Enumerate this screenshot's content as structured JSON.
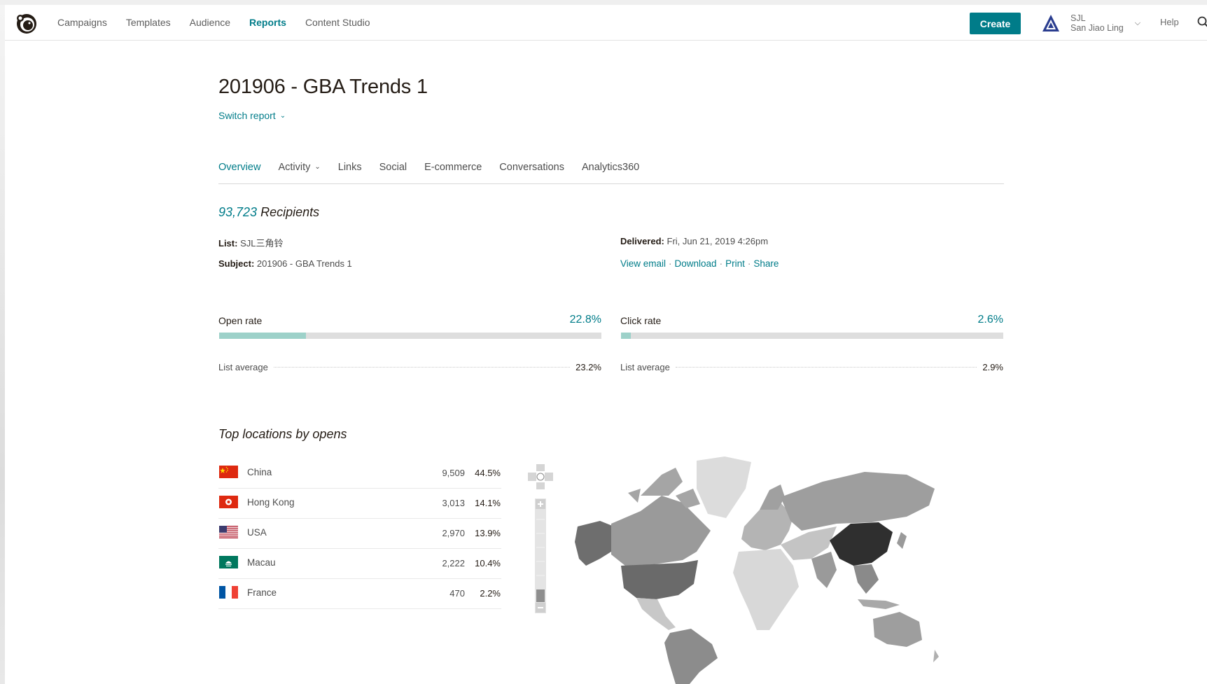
{
  "header": {
    "nav": [
      {
        "label": "Campaigns",
        "active": false
      },
      {
        "label": "Templates",
        "active": false
      },
      {
        "label": "Audience",
        "active": false
      },
      {
        "label": "Reports",
        "active": true
      },
      {
        "label": "Content Studio",
        "active": false
      }
    ],
    "create_label": "Create",
    "account": {
      "short": "SJL",
      "name": "San Jiao Ling"
    },
    "help_label": "Help"
  },
  "report": {
    "title": "201906 - GBA Trends 1",
    "switch_label": "Switch report",
    "tabs": [
      {
        "label": "Overview",
        "active": true
      },
      {
        "label": "Activity",
        "active": false
      },
      {
        "label": "Links",
        "active": false
      },
      {
        "label": "Social",
        "active": false
      },
      {
        "label": "E-commerce",
        "active": false
      },
      {
        "label": "Conversations",
        "active": false
      },
      {
        "label": "Analytics360",
        "active": false
      }
    ],
    "recipients_count": "93,723",
    "recipients_label": "Recipients",
    "list_label": "List:",
    "list_value": "SJL三角铃",
    "subject_label": "Subject:",
    "subject_value": "201906 - GBA Trends 1",
    "delivered_label": "Delivered:",
    "delivered_value": "Fri, Jun 21, 2019 4:26pm",
    "actions": [
      "View email",
      "Download",
      "Print",
      "Share"
    ]
  },
  "rates": {
    "open": {
      "label": "Open rate",
      "value": "22.8%",
      "fraction": 0.228,
      "avg_label": "List average",
      "avg_value": "23.2%"
    },
    "click": {
      "label": "Click rate",
      "value": "2.6%",
      "fraction": 0.026,
      "avg_label": "List average",
      "avg_value": "2.9%"
    }
  },
  "locations": {
    "title": "Top locations by opens",
    "rows": [
      {
        "country": "China",
        "count": "9,509",
        "percent": "44.5%",
        "flag": "china-flag"
      },
      {
        "country": "Hong Kong",
        "count": "3,013",
        "percent": "14.1%",
        "flag": "hong-kong-flag"
      },
      {
        "country": "USA",
        "count": "2,970",
        "percent": "13.9%",
        "flag": "usa-flag"
      },
      {
        "country": "Macau",
        "count": "2,222",
        "percent": "10.4%",
        "flag": "macau-flag"
      },
      {
        "country": "France",
        "count": "470",
        "percent": "2.2%",
        "flag": "france-flag"
      }
    ]
  },
  "colors": {
    "accent": "#007c89",
    "bar_fill": "#9dd1c9",
    "bar_track": "#dedede",
    "map_top": "#2f2f2f"
  },
  "icons": [
    "mailchimp-logo-icon",
    "account-avatar-icon",
    "chevron-down-icon",
    "search-icon",
    "map-pan-icon",
    "zoom-in-icon",
    "zoom-out-icon"
  ]
}
